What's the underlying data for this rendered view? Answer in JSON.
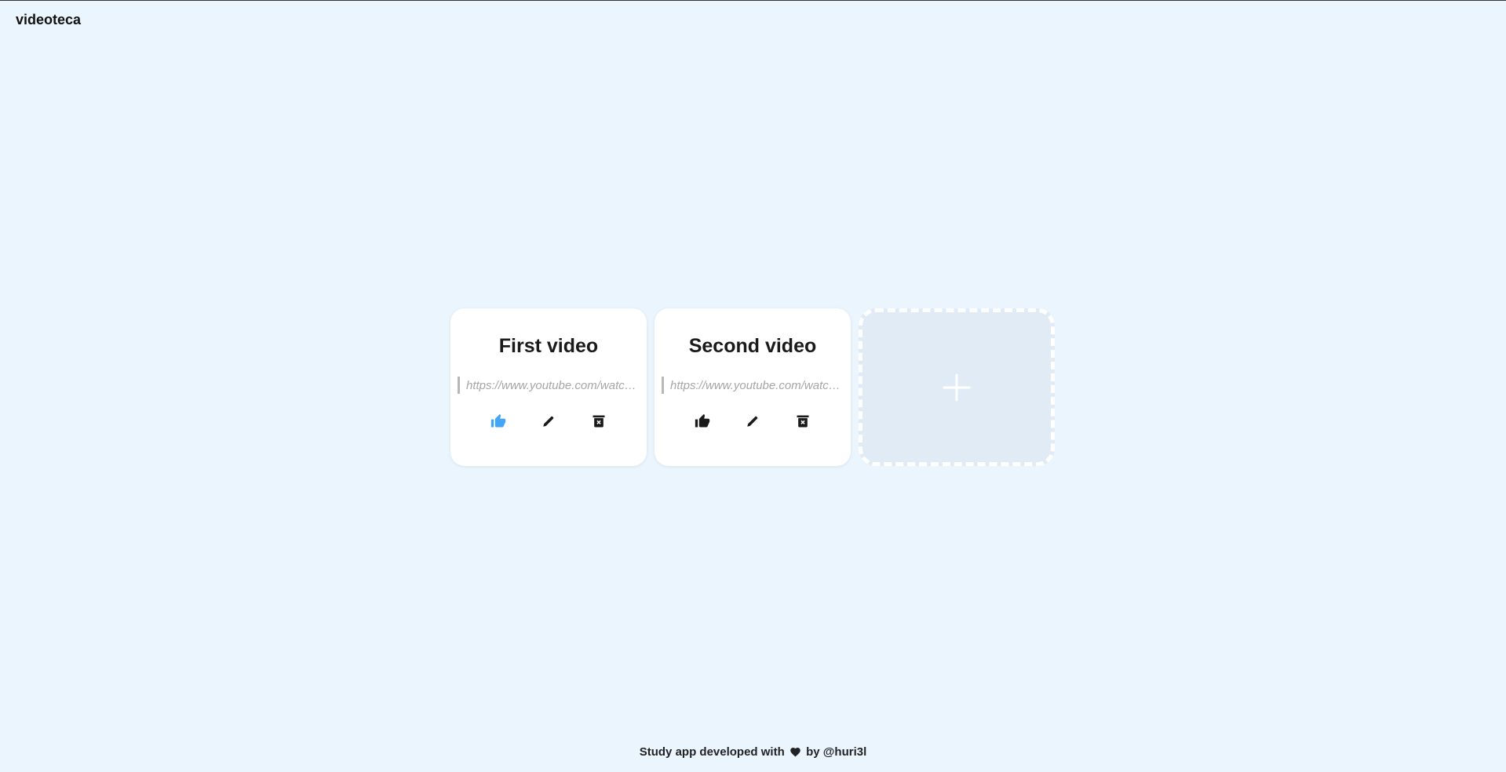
{
  "app": {
    "title": "videoteca"
  },
  "cards": [
    {
      "title": "First video",
      "url_placeholder": "https://www.youtube.com/watch?v=...",
      "liked": true,
      "like_icon": "thumbs-up-icon",
      "edit_icon": "pencil-icon",
      "delete_icon": "trash-icon"
    },
    {
      "title": "Second video",
      "url_placeholder": "https://www.youtube.com/watch?v=...",
      "liked": false,
      "like_icon": "thumbs-up-icon",
      "edit_icon": "pencil-icon",
      "delete_icon": "trash-icon"
    }
  ],
  "add_card": {
    "icon": "plus-icon"
  },
  "footer": {
    "text_before": "Study app developed with",
    "icon": "heart-icon",
    "text_after": "by @huri3l"
  },
  "colors": {
    "background": "#eaf5fe",
    "card": "#ffffff",
    "liked": "#42a5f5",
    "icon": "#1a1a1a",
    "add_card_bg": "#e1ebf5"
  }
}
